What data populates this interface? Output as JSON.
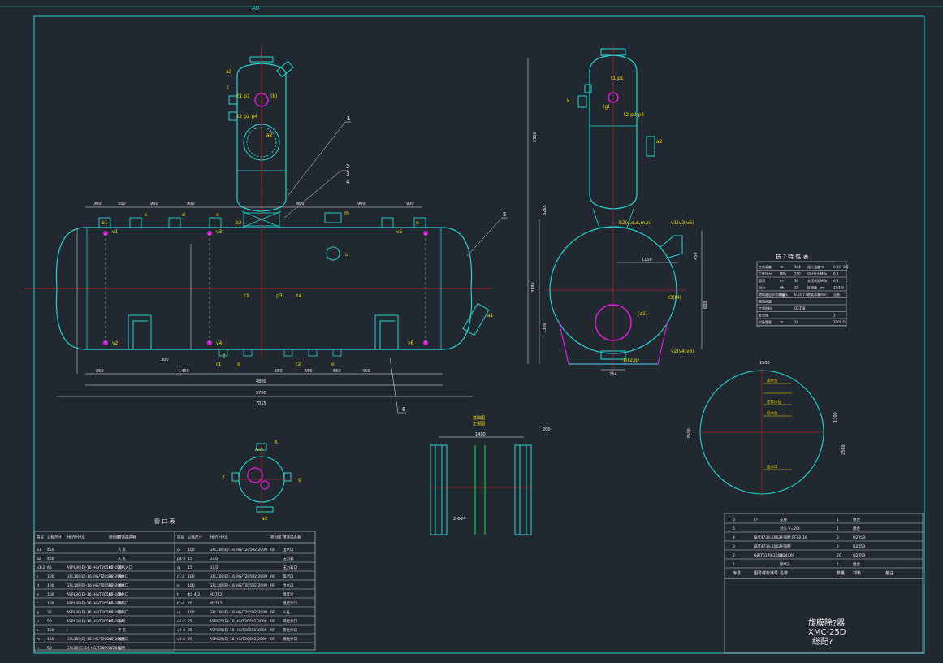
{
  "colors": {
    "background": "#212830",
    "outline": "#26d4d4",
    "dimension": "#f0f0f0",
    "center_line": "#e02020",
    "label": "#f0e000",
    "support": "#d81fd8",
    "level": "#20c040"
  },
  "sheet": {
    "top_mark": "A0",
    "title_lines": [
      "旋膜除?器",
      "XMC-25D",
      "総配?"
    ]
  },
  "front_view": {
    "nozzle_labels": [
      "b1",
      "b2",
      "c",
      "d",
      "e",
      "f",
      "m",
      "n",
      "v1",
      "v2",
      "v3",
      "v4",
      "v5",
      "v6",
      "t3",
      "p3",
      "t4",
      "r1",
      "q",
      "r2",
      "o",
      "u",
      "a1",
      "a2",
      "a3",
      "t1 p1",
      "t2 p2 p4",
      "(k)",
      "l"
    ],
    "dims_top": [
      "300",
      "550",
      "960",
      "900",
      "880",
      "960",
      "900"
    ],
    "dims_bottom": [
      "650",
      "1450",
      "4800",
      "300",
      "550",
      "550",
      "550",
      "450",
      "5700",
      "7015"
    ],
    "leaders": [
      "1",
      "2",
      "3",
      "4",
      "5",
      "6"
    ]
  },
  "side_view": {
    "labels": [
      "k",
      "(g)",
      "t1 p1",
      "t2 p2 p4",
      "a2",
      "b2(c,d,e,m,n)",
      "v1(v3,v5)",
      "t3(t4)",
      "v2(v4,v6)",
      "r1(r2,q)",
      "(a1)"
    ],
    "dims": [
      "1150",
      "2350",
      "450",
      "660",
      "3265",
      "1300",
      "3180",
      "254"
    ]
  },
  "section_view": {
    "title": "A-A",
    "labels": [
      "K",
      "f",
      "g",
      "a2"
    ]
  },
  "detail_view": {
    "dims": [
      "1400",
      "200",
      "2-Φ24"
    ],
    "labels": [
      "基础图",
      "正视图"
    ]
  },
  "circle_view": {
    "dims": [
      "1500",
      "1300",
      "3500",
      "2560"
    ],
    "labels": [
      "高水位",
      "正常水位",
      "低水位",
      "出水口"
    ]
  },
  "nozzle_table": {
    "title": "管 口 表",
    "headers": [
      "符号",
      "公称尺寸",
      "?接尺寸?准",
      "密封面",
      "用途或名称"
    ],
    "left_rows": [
      [
        "a1",
        "450",
        "",
        "",
        "人 孔"
      ],
      [
        "a2",
        "450",
        "",
        "",
        "人 孔"
      ],
      [
        "b1-2",
        "65",
        "ASPL30(E)-16 HG/T20592-2009",
        "RF",
        "蒸汽入口"
      ],
      [
        "c",
        "100",
        "GPL100(E)-16 HG/T20592-2009",
        "RF",
        "进水口"
      ],
      [
        "d",
        "100",
        "GPL100(E)-16 HG/T20592-2009",
        "RF",
        "进水口"
      ],
      [
        "e",
        "100",
        "ASPL80(E)-16 HG/T20592-2009",
        "RF",
        "进水口"
      ],
      [
        "f",
        "100",
        "ASPL80(E)-16 HG/T20592-2009",
        "RF",
        "排汽口"
      ],
      [
        "g",
        "32",
        "ASPL30(E)-16 HG/T20592-2009",
        "RF",
        "排汽口"
      ],
      [
        "h",
        "50",
        "ASPL50(E)-16 HG/T20592-2009",
        "RF",
        "备用"
      ],
      [
        "k",
        "150",
        "/",
        "/",
        "手 孔"
      ],
      [
        "m",
        "150",
        "GPL150(E)-16 HG/T20592-2009",
        "RF",
        "溢流口"
      ],
      [
        "n",
        "50",
        "GPL50(E)-16 HG/T20592-2009",
        "RF",
        "备用"
      ]
    ],
    "right_rows": [
      [
        "o",
        "100",
        "GPL100(E)-16 HG/T20592-2009",
        "RF",
        "出水口"
      ],
      [
        "p1-4",
        "15",
        "G1/2",
        "",
        "压力表"
      ],
      [
        "q",
        "15",
        "G1/2",
        "",
        "压力表口"
      ],
      [
        "r1-2",
        "100",
        "GPL100(E)-16 HG/T20592-2009",
        "RF",
        "排污口"
      ],
      [
        "s",
        "100",
        "GPL100(E)-16 HG/T20592-2009",
        "RF",
        "出水口"
      ],
      [
        "t",
        "Φ1 4/2",
        "M27X2",
        "",
        "温度计"
      ],
      [
        "t1-4",
        "20",
        "M27X2",
        "",
        "温度计口"
      ],
      [
        "u",
        "100",
        "GPL100(E)-16 HG/T20592-2009",
        "RF",
        "人孔"
      ],
      [
        "v1-2",
        "25",
        "ASPL25(E)-16 HG/T20592-2009",
        "RF",
        "液位计口"
      ],
      [
        "v3-4",
        "25",
        "ASPL25(E)-16 HG/T20592-2009",
        "RF",
        "液位计口"
      ],
      [
        "v5-6",
        "25",
        "ASPL25(E)-16 HG/T20592-2009",
        "RF",
        "液位计口"
      ]
    ]
  },
  "spec_table": {
    "title": "技 ? 特 性 表",
    "rows": [
      [
        "工作温度",
        "℃",
        "104",
        "设计温度",
        "℃",
        "0.02~0.1"
      ],
      [
        "工作压力",
        "MPa",
        "250",
        "设计压力",
        "MPa",
        "0.3"
      ],
      [
        "容积",
        "m³",
        "30",
        "水压试验",
        "MPa",
        "0.3"
      ],
      [
        "出力",
        "t/h",
        "25",
        "处理量",
        "m³",
        "25/1.6"
      ],
      [
        "除氧器出水含氧量",
        "mg/L",
        "0.05/7.0",
        "除氧水箱",
        "mm",
        "见图"
      ],
      [
        "腐蚀裕量",
        "",
        "",
        "",
        "",
        ""
      ],
      [
        "主要材料",
        "",
        "Q235B",
        "",
        "",
        ""
      ],
      [
        "安全阀",
        "",
        "",
        "",
        "",
        "3"
      ],
      [
        "设备重量",
        "℃",
        "10",
        "",
        "",
        "2500 D"
      ]
    ]
  },
  "parts_list": {
    "rows": [
      [
        "6",
        "L?",
        "支座",
        "1",
        "组合",
        ""
      ],
      [
        "5",
        "",
        "封头 V=20t",
        "1",
        "组合",
        ""
      ],
      [
        "4",
        "JB/T4736-2002",
        "补强圈 RF80-16",
        "2",
        "Q235B",
        ""
      ],
      [
        "3",
        "JB/T4736-2002",
        "补强圈",
        "2",
        "Q235B",
        ""
      ],
      [
        "2",
        "GB/T6170-2000",
        "M24X95",
        "20",
        "Q235B",
        ""
      ],
      [
        "1",
        "",
        "除氧头",
        "1",
        "组合",
        ""
      ]
    ],
    "header": [
      "序号",
      "图号或标准号",
      "名称",
      "数量",
      "材料",
      "备注"
    ]
  }
}
